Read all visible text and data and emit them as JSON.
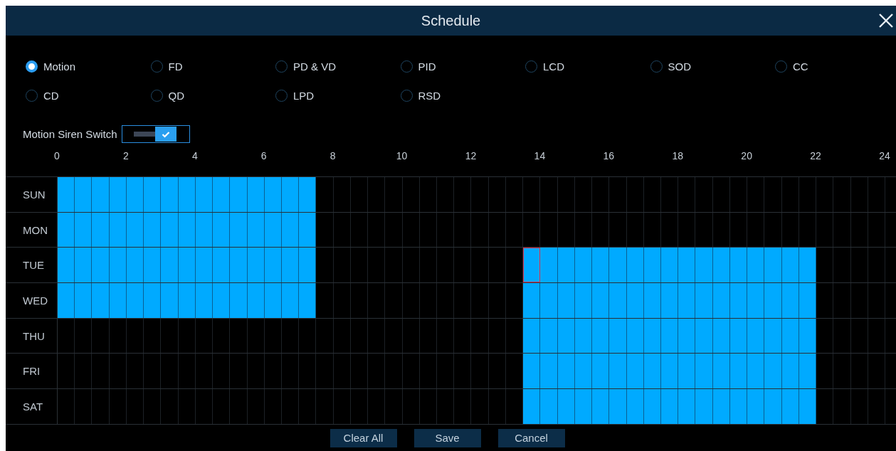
{
  "window": {
    "title": "Schedule"
  },
  "detection_types": [
    {
      "label": "Motion",
      "selected": true
    },
    {
      "label": "FD",
      "selected": false
    },
    {
      "label": "PD & VD",
      "selected": false
    },
    {
      "label": "PID",
      "selected": false
    },
    {
      "label": "LCD",
      "selected": false
    },
    {
      "label": "SOD",
      "selected": false
    },
    {
      "label": "CC",
      "selected": false
    },
    {
      "label": "CD",
      "selected": false
    },
    {
      "label": "QD",
      "selected": false
    },
    {
      "label": "LPD",
      "selected": false
    },
    {
      "label": "RSD",
      "selected": false
    }
  ],
  "siren_switch": {
    "label": "Motion Siren Switch",
    "on": true
  },
  "hours": [
    "0",
    "2",
    "4",
    "6",
    "8",
    "10",
    "12",
    "14",
    "16",
    "18",
    "20",
    "22",
    "24"
  ],
  "days": [
    {
      "label": "SUN",
      "cells": [
        true,
        true,
        true,
        true,
        true,
        true,
        true,
        true,
        true,
        true,
        true,
        true,
        true,
        true,
        true,
        false,
        false,
        false,
        false,
        false,
        false,
        false,
        false,
        false,
        false,
        false,
        false,
        false,
        false,
        false,
        false,
        false,
        false,
        false,
        false,
        false,
        false,
        false,
        false,
        false,
        false,
        false,
        false,
        false,
        false,
        false,
        false,
        false
      ],
      "focused": [
        false,
        false,
        false,
        false,
        false,
        false,
        false,
        false,
        false,
        false,
        false,
        false,
        false,
        false,
        false,
        false,
        false,
        false,
        false,
        false,
        false,
        false,
        false,
        false,
        false,
        false,
        false,
        false,
        false,
        false,
        false,
        false,
        false,
        false,
        false,
        false,
        false,
        false,
        false,
        false,
        false,
        false,
        false,
        false,
        false,
        false,
        false,
        false
      ]
    },
    {
      "label": "MON",
      "cells": [
        true,
        true,
        true,
        true,
        true,
        true,
        true,
        true,
        true,
        true,
        true,
        true,
        true,
        true,
        true,
        false,
        false,
        false,
        false,
        false,
        false,
        false,
        false,
        false,
        false,
        false,
        false,
        false,
        false,
        false,
        false,
        false,
        false,
        false,
        false,
        false,
        false,
        false,
        false,
        false,
        false,
        false,
        false,
        false,
        false,
        false,
        false,
        false
      ],
      "focused": [
        false,
        false,
        false,
        false,
        false,
        false,
        false,
        false,
        false,
        false,
        false,
        false,
        false,
        false,
        false,
        false,
        false,
        false,
        false,
        false,
        false,
        false,
        false,
        false,
        false,
        false,
        false,
        false,
        false,
        false,
        false,
        false,
        false,
        false,
        false,
        false,
        false,
        false,
        false,
        false,
        false,
        false,
        false,
        false,
        false,
        false,
        false,
        false
      ]
    },
    {
      "label": "TUE",
      "cells": [
        true,
        true,
        true,
        true,
        true,
        true,
        true,
        true,
        true,
        true,
        true,
        true,
        true,
        true,
        true,
        false,
        false,
        false,
        false,
        false,
        false,
        false,
        false,
        false,
        false,
        false,
        false,
        true,
        true,
        true,
        true,
        true,
        true,
        true,
        true,
        true,
        true,
        true,
        true,
        true,
        true,
        true,
        true,
        true,
        false,
        false,
        false,
        false
      ],
      "focused": [
        false,
        false,
        false,
        false,
        false,
        false,
        false,
        false,
        false,
        false,
        false,
        false,
        false,
        false,
        false,
        false,
        false,
        false,
        false,
        false,
        false,
        false,
        false,
        false,
        false,
        false,
        false,
        true,
        false,
        false,
        false,
        false,
        false,
        false,
        false,
        false,
        false,
        false,
        false,
        false,
        false,
        false,
        false,
        false,
        false,
        false,
        false,
        false
      ]
    },
    {
      "label": "WED",
      "cells": [
        true,
        true,
        true,
        true,
        true,
        true,
        true,
        true,
        true,
        true,
        true,
        true,
        true,
        true,
        true,
        false,
        false,
        false,
        false,
        false,
        false,
        false,
        false,
        false,
        false,
        false,
        false,
        true,
        true,
        true,
        true,
        true,
        true,
        true,
        true,
        true,
        true,
        true,
        true,
        true,
        true,
        true,
        true,
        true,
        false,
        false,
        false,
        false
      ],
      "focused": [
        false,
        false,
        false,
        false,
        false,
        false,
        false,
        false,
        false,
        false,
        false,
        false,
        false,
        false,
        false,
        false,
        false,
        false,
        false,
        false,
        false,
        false,
        false,
        false,
        false,
        false,
        false,
        false,
        false,
        false,
        false,
        false,
        false,
        false,
        false,
        false,
        false,
        false,
        false,
        false,
        false,
        false,
        false,
        false,
        false,
        false,
        false,
        false
      ]
    },
    {
      "label": "THU",
      "cells": [
        false,
        false,
        false,
        false,
        false,
        false,
        false,
        false,
        false,
        false,
        false,
        false,
        false,
        false,
        false,
        false,
        false,
        false,
        false,
        false,
        false,
        false,
        false,
        false,
        false,
        false,
        false,
        true,
        true,
        true,
        true,
        true,
        true,
        true,
        true,
        true,
        true,
        true,
        true,
        true,
        true,
        true,
        true,
        true,
        false,
        false,
        false,
        false
      ],
      "focused": [
        false,
        false,
        false,
        false,
        false,
        false,
        false,
        false,
        false,
        false,
        false,
        false,
        false,
        false,
        false,
        false,
        false,
        false,
        false,
        false,
        false,
        false,
        false,
        false,
        false,
        false,
        false,
        false,
        false,
        false,
        false,
        false,
        false,
        false,
        false,
        false,
        false,
        false,
        false,
        false,
        false,
        false,
        false,
        false,
        false,
        false,
        false,
        false
      ]
    },
    {
      "label": "FRI",
      "cells": [
        false,
        false,
        false,
        false,
        false,
        false,
        false,
        false,
        false,
        false,
        false,
        false,
        false,
        false,
        false,
        false,
        false,
        false,
        false,
        false,
        false,
        false,
        false,
        false,
        false,
        false,
        false,
        true,
        true,
        true,
        true,
        true,
        true,
        true,
        true,
        true,
        true,
        true,
        true,
        true,
        true,
        true,
        true,
        true,
        false,
        false,
        false,
        false
      ],
      "focused": [
        false,
        false,
        false,
        false,
        false,
        false,
        false,
        false,
        false,
        false,
        false,
        false,
        false,
        false,
        false,
        false,
        false,
        false,
        false,
        false,
        false,
        false,
        false,
        false,
        false,
        false,
        false,
        false,
        false,
        false,
        false,
        false,
        false,
        false,
        false,
        false,
        false,
        false,
        false,
        false,
        false,
        false,
        false,
        false,
        false,
        false,
        false,
        false
      ]
    },
    {
      "label": "SAT",
      "cells": [
        false,
        false,
        false,
        false,
        false,
        false,
        false,
        false,
        false,
        false,
        false,
        false,
        false,
        false,
        false,
        false,
        false,
        false,
        false,
        false,
        false,
        false,
        false,
        false,
        false,
        false,
        false,
        true,
        true,
        true,
        true,
        true,
        true,
        true,
        true,
        true,
        true,
        true,
        true,
        true,
        true,
        true,
        true,
        true,
        false,
        false,
        false,
        false
      ],
      "focused": [
        false,
        false,
        false,
        false,
        false,
        false,
        false,
        false,
        false,
        false,
        false,
        false,
        false,
        false,
        false,
        false,
        false,
        false,
        false,
        false,
        false,
        false,
        false,
        false,
        false,
        false,
        false,
        false,
        false,
        false,
        false,
        false,
        false,
        false,
        false,
        false,
        false,
        false,
        false,
        false,
        false,
        false,
        false,
        false,
        false,
        false,
        false,
        false
      ]
    }
  ],
  "buttons": [
    "Clear All",
    "Save",
    "Cancel"
  ]
}
